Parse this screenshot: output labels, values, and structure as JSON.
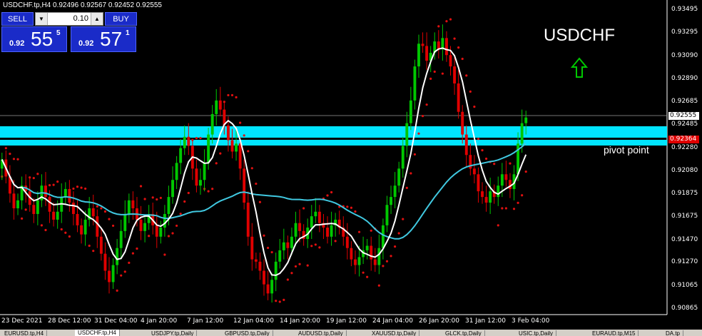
{
  "header": {
    "info_line": "USDCHF.tp,H4  0.92496 0.92567 0.92452 0.92555"
  },
  "trade_panel": {
    "sell_label": "SELL",
    "buy_label": "BUY",
    "lot_value": "0.10",
    "sell_prefix": "0.92",
    "sell_big": "55",
    "sell_sup": "5",
    "buy_prefix": "0.92",
    "buy_big": "57",
    "buy_sup": "1"
  },
  "annotations": {
    "symbol_title": "USDCHF",
    "pivot_label": "pivot point",
    "arrow_icon": "up-arrow-icon"
  },
  "tabs": [
    {
      "label": "EURUSD.tp,H4",
      "active": false
    },
    {
      "label": "USDCHF.tp,H4",
      "active": true
    },
    {
      "label": "USDJPY.tp,Daily",
      "active": false
    },
    {
      "label": "GBPUSD.tp,Daily",
      "active": false
    },
    {
      "label": "AUDUSD.tp,Daily",
      "active": false
    },
    {
      "label": "XAUUSD.tp,Daily",
      "active": false
    },
    {
      "label": "GLCK.tp,Daily",
      "active": false
    },
    {
      "label": "USIC.tp,Daily",
      "active": false
    },
    {
      "label": "EURAUD.tp,M15",
      "active": false
    },
    {
      "label": "DA.tp",
      "active": false
    }
  ],
  "colors": {
    "bull": "#00c800",
    "bear": "#e00000",
    "zone": "#00e5ff",
    "sar": "#e01010",
    "ma_fast": "#ffffff",
    "ma_slow": "#40c8e0",
    "current_price_tag": "#ffffff",
    "pivot_tag": "#e00000"
  },
  "chart_data": {
    "type": "candlestick",
    "symbol": "USDCHF.tp",
    "timeframe": "H4",
    "ylim": [
      0.9082,
      0.9356
    ],
    "y_ticks": [
      "0.93495",
      "0.93295",
      "0.93090",
      "0.92890",
      "0.92685",
      "0.92485",
      "0.92280",
      "0.92080",
      "0.91875",
      "0.91675",
      "0.91470",
      "0.91270",
      "0.91065",
      "0.90865"
    ],
    "x_ticks": [
      "23 Dec 2021",
      "28 Dec 12:00",
      "31 Dec 04:00",
      "4 Jan 20:00",
      "7 Jan 12:00",
      "12 Jan 04:00",
      "14 Jan 20:00",
      "19 Jan 12:00",
      "24 Jan 04:00",
      "26 Jan 20:00",
      "31 Jan 12:00",
      "3 Feb 04:00"
    ],
    "current_price": "0.92555",
    "pivot_zone": {
      "upper": 0.9248,
      "lower": 0.9234,
      "label_value": "0.92364"
    },
    "closes": [
      0.9218,
      0.9203,
      0.9188,
      0.9175,
      0.9182,
      0.9195,
      0.919,
      0.9178,
      0.917,
      0.9182,
      0.9195,
      0.9185,
      0.9172,
      0.9165,
      0.9172,
      0.9185,
      0.9192,
      0.918,
      0.917,
      0.916,
      0.9152,
      0.9165,
      0.9175,
      0.9168,
      0.915,
      0.9135,
      0.912,
      0.911,
      0.9125,
      0.914,
      0.9155,
      0.917,
      0.9182,
      0.9175,
      0.9165,
      0.9155,
      0.9162,
      0.917,
      0.916,
      0.915,
      0.9158,
      0.917,
      0.9185,
      0.92,
      0.9215,
      0.9228,
      0.9238,
      0.923,
      0.921,
      0.9195,
      0.92,
      0.9215,
      0.924,
      0.9258,
      0.927,
      0.9262,
      0.9248,
      0.9235,
      0.9225,
      0.9232,
      0.921,
      0.918,
      0.915,
      0.913,
      0.9128,
      0.912,
      0.9108,
      0.91,
      0.9112,
      0.9128,
      0.9138,
      0.9145,
      0.914,
      0.915,
      0.9162,
      0.9155,
      0.9148,
      0.9158,
      0.9168,
      0.9172,
      0.9162,
      0.9158,
      0.915,
      0.916,
      0.9165,
      0.9158,
      0.915,
      0.914,
      0.913,
      0.9125,
      0.9132,
      0.9138,
      0.9142,
      0.913,
      0.9125,
      0.914,
      0.916,
      0.9178,
      0.9185,
      0.9195,
      0.921,
      0.923,
      0.925,
      0.927,
      0.93,
      0.932,
      0.9318,
      0.9305,
      0.9312,
      0.9322,
      0.9315,
      0.9325,
      0.931,
      0.93,
      0.9285,
      0.926,
      0.924,
      0.9222,
      0.921,
      0.9205,
      0.919,
      0.9185,
      0.918,
      0.919,
      0.9185,
      0.9195,
      0.9205,
      0.92,
      0.9192,
      0.9205,
      0.9232,
      0.925,
      0.9255
    ]
  }
}
